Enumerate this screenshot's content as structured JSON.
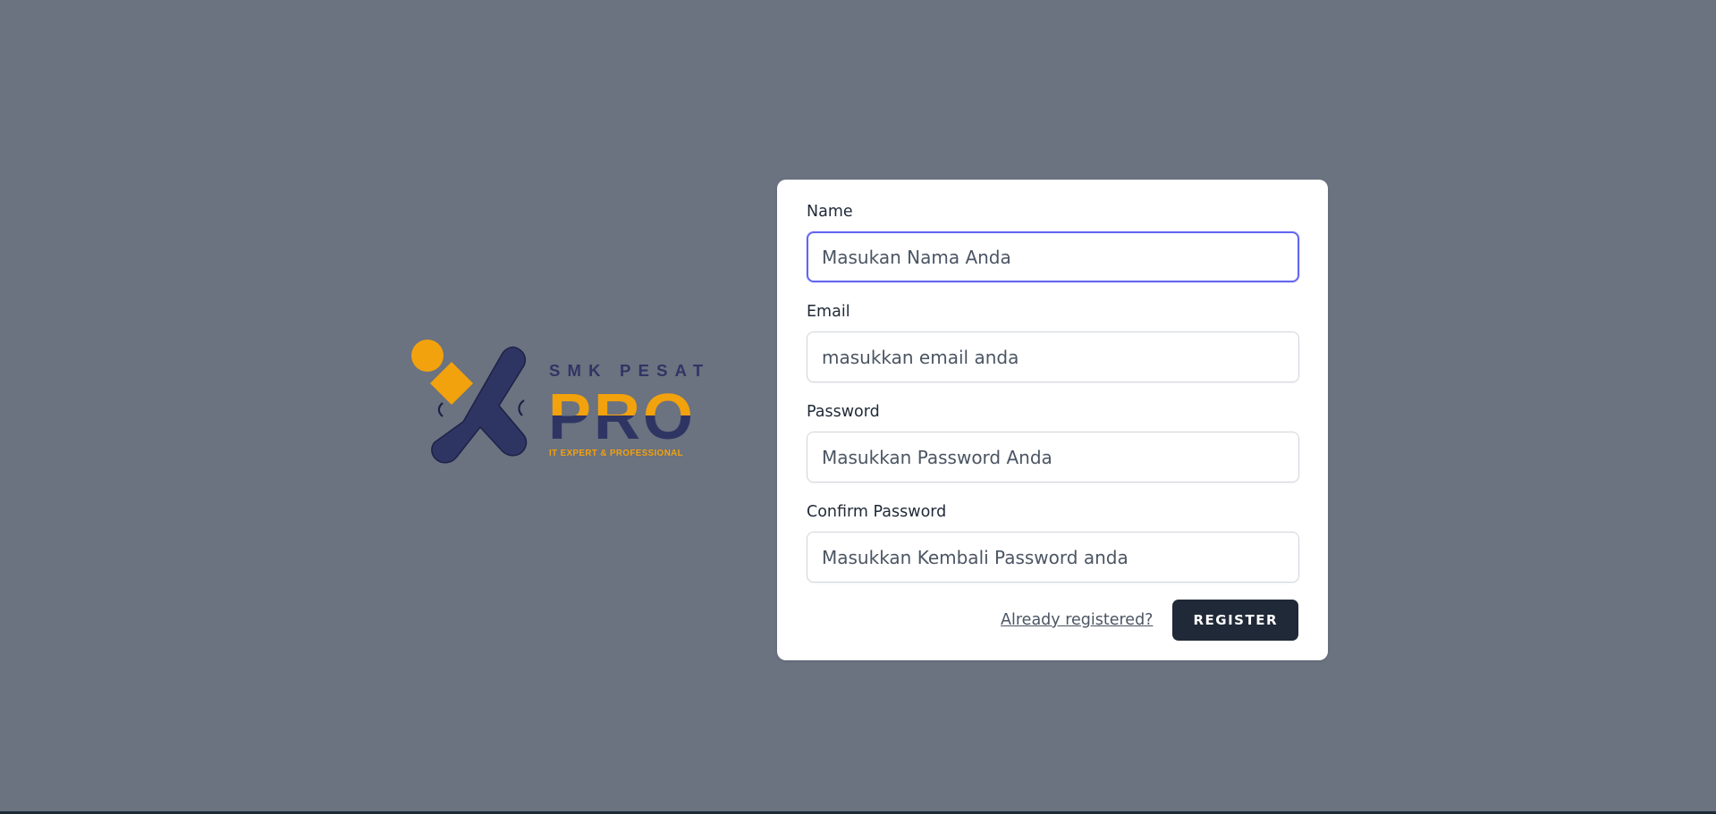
{
  "logo": {
    "brand_top": "SMK PESAT",
    "brand_main": "PRO",
    "tagline": "IT EXPERT & PROFESSIONAL",
    "colors": {
      "navy": "#2f3563",
      "orange": "#f2a20c"
    }
  },
  "form": {
    "name": {
      "label": "Name",
      "placeholder": "Masukan Nama Anda",
      "value": ""
    },
    "email": {
      "label": "Email",
      "placeholder": "masukkan email anda",
      "value": ""
    },
    "password": {
      "label": "Password",
      "placeholder": "Masukkan Password Anda",
      "value": ""
    },
    "confirm_password": {
      "label": "Confirm Password",
      "placeholder": "Masukkan Kembali Password anda",
      "value": ""
    },
    "already_registered_link": "Already registered?",
    "register_button": "REGISTER"
  },
  "colors": {
    "background": "#6b7280",
    "card": "#ffffff",
    "focus_ring": "#6366f1",
    "button": "#1f2937"
  }
}
